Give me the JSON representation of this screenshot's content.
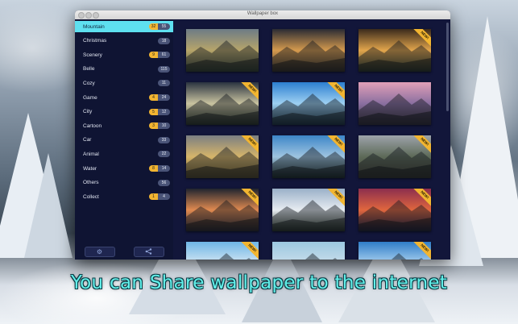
{
  "window": {
    "title": "Wallpaper box"
  },
  "sidebar": {
    "categories": [
      {
        "label": "Mountain",
        "new": "32",
        "total": "55",
        "selected": true
      },
      {
        "label": "Christmas",
        "new": "",
        "total": "18",
        "selected": false
      },
      {
        "label": "Scenery",
        "new": "9",
        "total": "61",
        "selected": false
      },
      {
        "label": "Belle",
        "new": "",
        "total": "115",
        "selected": false
      },
      {
        "label": "Cozy",
        "new": "",
        "total": "11",
        "selected": false
      },
      {
        "label": "Game",
        "new": "4",
        "total": "24",
        "selected": false
      },
      {
        "label": "City",
        "new": "5",
        "total": "12",
        "selected": false
      },
      {
        "label": "Cartoon",
        "new": "3",
        "total": "10",
        "selected": false
      },
      {
        "label": "Car",
        "new": "",
        "total": "33",
        "selected": false
      },
      {
        "label": "Animal",
        "new": "",
        "total": "22",
        "selected": false
      },
      {
        "label": "Water",
        "new": "8",
        "total": "14",
        "selected": false
      },
      {
        "label": "Others",
        "new": "",
        "total": "56",
        "selected": false
      },
      {
        "label": "Collect",
        "new": "1",
        "total": "4",
        "selected": false
      }
    ],
    "footer": {
      "settings_icon": "gear-icon",
      "share_icon": "share-icon"
    }
  },
  "gallery": {
    "new_label": "NEW!",
    "thumbnails": [
      {
        "new": false,
        "colors": [
          "#6d7b86",
          "#b7a56a",
          "#3c4a34"
        ]
      },
      {
        "new": false,
        "colors": [
          "#2b2c33",
          "#d59a4e",
          "#3b3226"
        ]
      },
      {
        "new": true,
        "colors": [
          "#3a2a1c",
          "#e2a54c",
          "#2b3a28"
        ]
      },
      {
        "new": true,
        "colors": [
          "#2a3340",
          "#c9c3a0",
          "#2f3a2a"
        ]
      },
      {
        "new": true,
        "colors": [
          "#2c7fd0",
          "#9dd0f2",
          "#1d3b4e"
        ]
      },
      {
        "new": false,
        "colors": [
          "#e1a0b8",
          "#8a6fa0",
          "#3a3240"
        ]
      },
      {
        "new": true,
        "colors": [
          "#7b7f82",
          "#d6b56a",
          "#6b5a2a"
        ]
      },
      {
        "new": true,
        "colors": [
          "#3d86c8",
          "#9ec4e0",
          "#1c2f2a"
        ]
      },
      {
        "new": true,
        "colors": [
          "#9da3aa",
          "#5d6a58",
          "#3d3a2e"
        ]
      },
      {
        "new": true,
        "colors": [
          "#20252f",
          "#e08a50",
          "#2e2830"
        ]
      },
      {
        "new": true,
        "colors": [
          "#9ab0c8",
          "#e7ecf1",
          "#2d3a2a"
        ]
      },
      {
        "new": true,
        "colors": [
          "#8c2e4e",
          "#e0663e",
          "#1e1c3a"
        ]
      },
      {
        "new": true,
        "colors": [
          "#6fb6e6",
          "#cfe4f2",
          "#2a3a3a"
        ]
      },
      {
        "new": false,
        "colors": [
          "#9cc8e0",
          "#c6dcea",
          "#5a6a7a"
        ]
      },
      {
        "new": true,
        "colors": [
          "#2f7dc8",
          "#a6cfee",
          "#1f3a3a"
        ]
      }
    ]
  },
  "caption": "You can Share wallpaper to the internet"
}
